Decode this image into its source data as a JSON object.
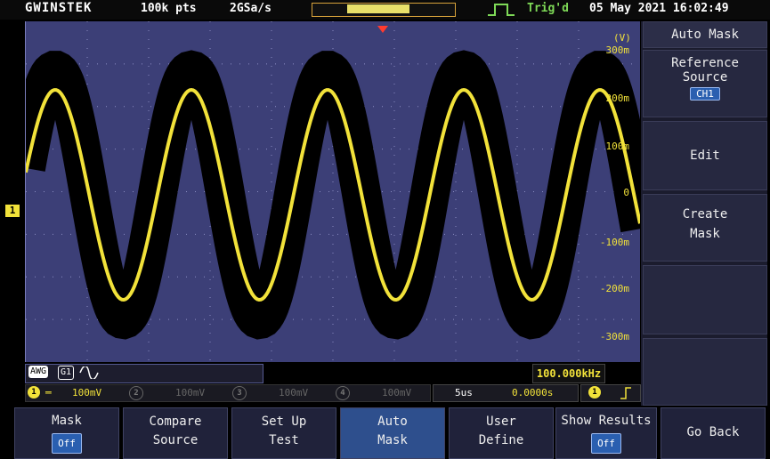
{
  "topbar": {
    "brand": "GWINSTEK",
    "record_length": "100k pts",
    "sample_rate": "2GSa/s",
    "trig_status": "Trig'd",
    "datetime": "05 May 2021 16:02:49"
  },
  "screen": {
    "unit_label": "(V)",
    "y_labels": [
      "300m",
      "200m",
      "100m",
      "0",
      "-100m",
      "-200m",
      "-300m"
    ],
    "ch1_marker": "1"
  },
  "awg": {
    "label": "AWG",
    "channel": "G1",
    "wave_icon": "sine-icon"
  },
  "freq": {
    "value": "100.000kHz"
  },
  "channels": {
    "ch1": {
      "num": "1",
      "scale": "100mV"
    },
    "ch2": {
      "num": "2",
      "scale": "100mV"
    },
    "ch3": {
      "num": "3",
      "scale": "100mV"
    },
    "ch4": {
      "num": "4",
      "scale": "100mV"
    }
  },
  "timebase": {
    "scale": "5us",
    "offset": "0.0000s"
  },
  "trigger": {
    "source": "1",
    "slope_icon": "rising-edge-icon"
  },
  "side_menu": {
    "title": "Auto Mask",
    "ref_label_1": "Reference",
    "ref_label_2": "Source",
    "ref_value": "CH1",
    "edit": "Edit",
    "create_1": "Create",
    "create_2": "Mask"
  },
  "bottom_menu": {
    "mask_label": "Mask",
    "mask_value": "Off",
    "compare_1": "Compare",
    "compare_2": "Source",
    "setup_1": "Set Up",
    "setup_2": "Test",
    "auto_1": "Auto",
    "auto_2": "Mask",
    "user_1": "User",
    "user_2": "Define",
    "results_label": "Show Results",
    "results_value": "Off",
    "goback": "Go Back"
  },
  "colors": {
    "ch1": "#f2e23a",
    "grid_bg": "#3c3f77",
    "mask": "#000000",
    "trig_ok": "#7ed957"
  }
}
